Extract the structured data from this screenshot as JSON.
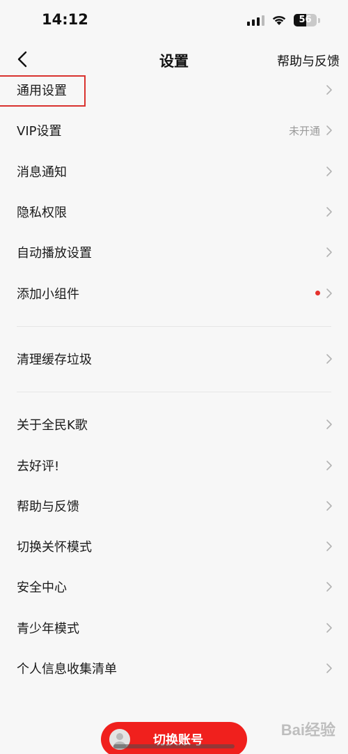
{
  "status_bar": {
    "time": "14:12",
    "battery": "56",
    "battery_level": 0.56,
    "icons": [
      "signal-icon",
      "wifi-icon",
      "battery-icon"
    ]
  },
  "nav": {
    "back_icon": "chevron-left-icon",
    "title": "设置",
    "help": "帮助与反馈"
  },
  "menu": {
    "group1": [
      {
        "label": "通用设置",
        "extra": ""
      },
      {
        "label": "VIP设置",
        "extra": "未开通"
      },
      {
        "label": "消息通知",
        "extra": ""
      },
      {
        "label": "隐私权限",
        "extra": ""
      },
      {
        "label": "自动播放设置",
        "extra": ""
      },
      {
        "label": "添加小组件",
        "extra": "",
        "badge": "red-dot"
      }
    ],
    "group2": [
      {
        "label": "清理缓存垃圾",
        "extra": ""
      }
    ],
    "group3": [
      {
        "label": "关于全民K歌",
        "extra": ""
      },
      {
        "label": "去好评!",
        "extra": ""
      },
      {
        "label": "帮助与反馈",
        "extra": ""
      },
      {
        "label": "切换关怀模式",
        "extra": ""
      },
      {
        "label": "安全中心",
        "extra": ""
      },
      {
        "label": "青少年模式",
        "extra": ""
      },
      {
        "label": "个人信息收集清单",
        "extra": ""
      }
    ]
  },
  "switch_account": {
    "label": "切换账号"
  },
  "colors": {
    "accent": "#f0201d",
    "highlight": "#d9322e",
    "background": "#f7f7f7"
  },
  "watermark": "Bai经验"
}
